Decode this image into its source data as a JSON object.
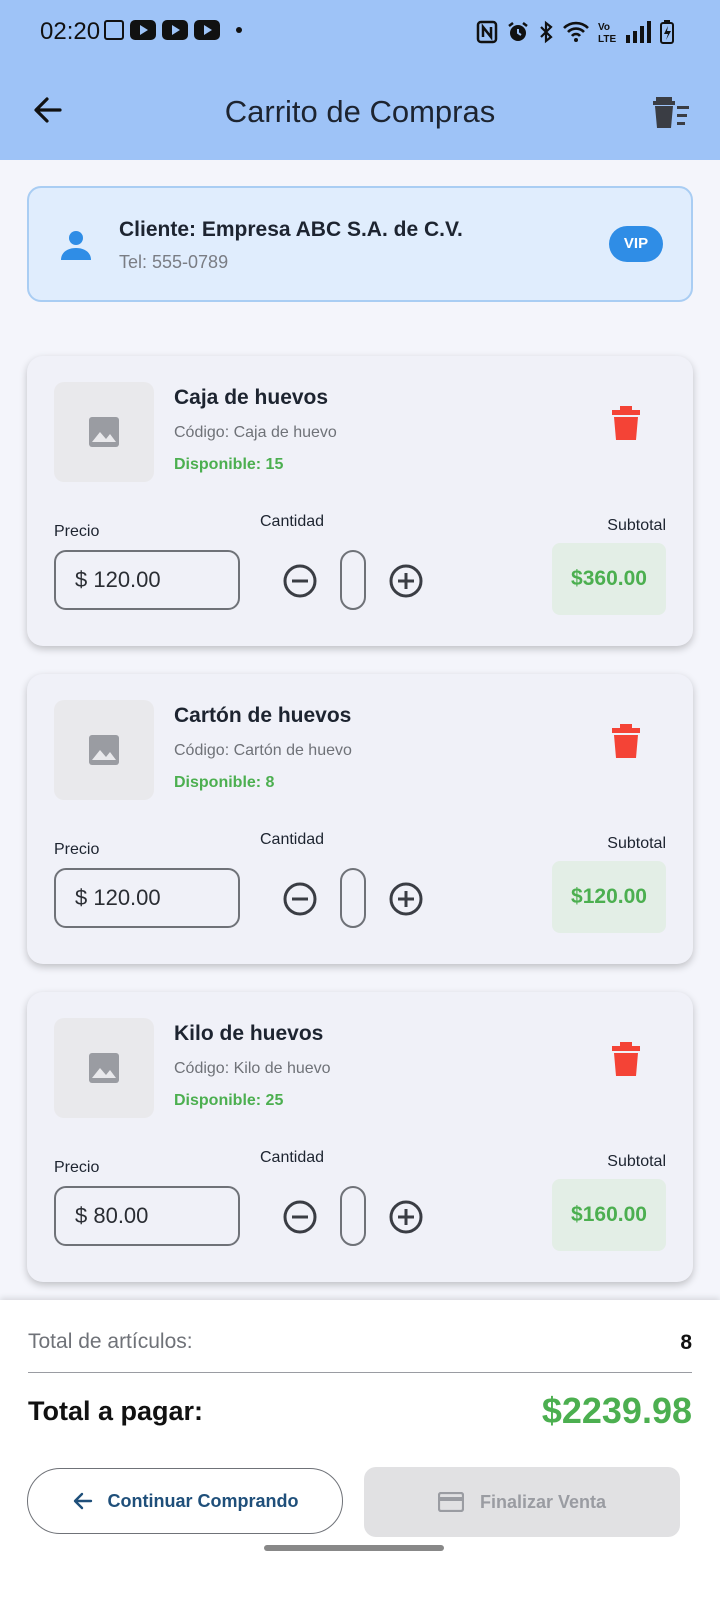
{
  "status_bar": {
    "time": "02:20"
  },
  "app_bar": {
    "title": "Carrito de Compras"
  },
  "customer": {
    "name": "Cliente: Empresa ABC S.A. de C.V.",
    "phone": "Tel: 555-0789",
    "badge": "VIP"
  },
  "labels": {
    "price": "Precio",
    "quantity": "Cantidad",
    "subtotal": "Subtotal"
  },
  "products": [
    {
      "name": "Caja de huevos",
      "code": "Código: Caja de huevo",
      "stock": "Disponible: 15",
      "price": "$ 120.00",
      "subtotal": "$360.00"
    },
    {
      "name": "Cartón de huevos",
      "code": "Código: Cartón de huevo",
      "stock": "Disponible: 8",
      "price": "$ 120.00",
      "subtotal": "$120.00"
    },
    {
      "name": "Kilo de huevos",
      "code": "Código: Kilo de huevo",
      "stock": "Disponible: 25",
      "price": "$ 80.00",
      "subtotal": "$160.00"
    }
  ],
  "summary": {
    "items_label": "Total de artículos:",
    "items_value": "8",
    "total_label": "Total a pagar:",
    "total_value": "$2239.98"
  },
  "actions": {
    "continue_label": "Continuar Comprando",
    "finish_label": "Finalizar Venta"
  },
  "colors": {
    "app_bar": "#9ec3f7",
    "accent": "#2f8de6",
    "success": "#4caf50",
    "danger": "#f44336"
  },
  "icons": {
    "back": "arrow-left-icon",
    "clear_cart": "delete-sweep-icon",
    "customer": "person-icon",
    "delete": "trash-icon",
    "image": "image-placeholder-icon",
    "minus": "remove-circle-icon",
    "plus": "add-circle-icon",
    "card": "credit-card-icon"
  }
}
